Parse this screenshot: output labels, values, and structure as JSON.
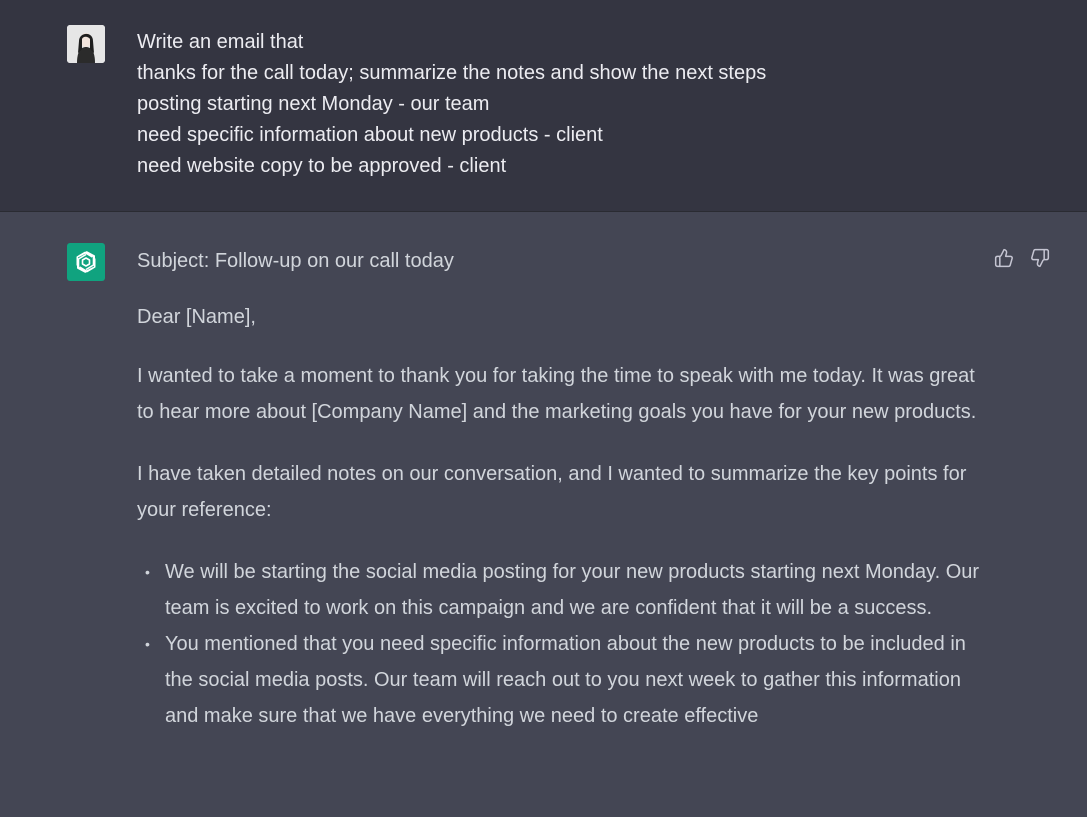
{
  "user_message": {
    "lines": [
      "Write an email that",
      "thanks for the call today; summarize the notes and show the next steps",
      "posting starting next Monday - our team",
      "need specific information about new products - client",
      "need website copy to be approved - client"
    ]
  },
  "assistant_message": {
    "subject": "Subject: Follow-up on our call today",
    "greeting": "Dear [Name],",
    "paragraphs": [
      "I wanted to take a moment to thank you for taking the time to speak with me today. It was great to hear more about [Company Name] and the marketing goals you have for your new products.",
      "I have taken detailed notes on our conversation, and I wanted to summarize the key points for your reference:"
    ],
    "bullets": [
      "We will be starting the social media posting for your new products starting next Monday. Our team is excited to work on this campaign and we are confident that it will be a success.",
      "You mentioned that you need specific information about the new products to be included in the social media posts. Our team will reach out to you next week to gather this information and make sure that we have everything we need to create effective"
    ]
  },
  "icons": {
    "user_avatar": "user-avatar-photo",
    "assistant_avatar": "openai-logo-icon",
    "thumbs_up": "thumbs-up-icon",
    "thumbs_down": "thumbs-down-icon"
  },
  "colors": {
    "user_bg": "#343541",
    "assistant_bg": "#444654",
    "assistant_avatar_bg": "#10a37f"
  }
}
